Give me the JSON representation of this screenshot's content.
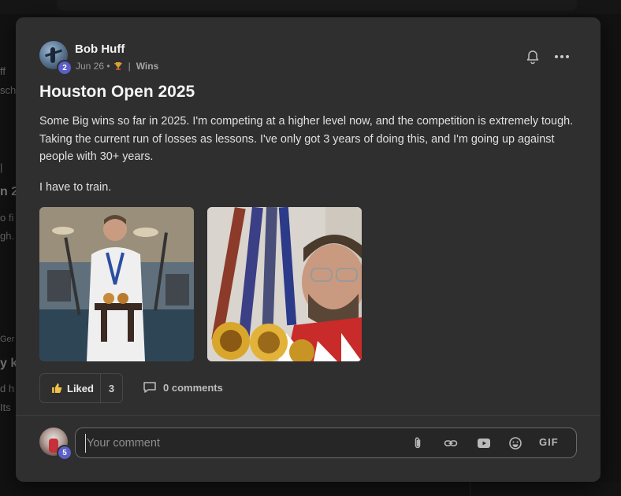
{
  "post": {
    "author": "Bob Huff",
    "author_level": "2",
    "date": "Jun 26 •",
    "category_separator": "|",
    "category": "Wins",
    "title": "Houston Open 2025",
    "paragraphs": [
      "Some Big wins so far in 2025. I'm competing at a higher level now, and the competition is extremely tough. Taking the current run of losses as lessons. I've only got 3 years of doing this, and I'm going up against people with 30+ years.",
      "I have to train."
    ],
    "images": [
      "karate-gi-medals-photo",
      "medals-selfie-photo"
    ],
    "like_label": "Liked",
    "like_count": "3",
    "comments_label": "0 comments"
  },
  "composer": {
    "user_level": "5",
    "placeholder": "Your comment",
    "gif_label": "GIF"
  },
  "background": {
    "snippets": [
      "ff",
      "sch",
      "|",
      "n 2",
      "o fi",
      "gh.",
      "Ger",
      "y k",
      "d h",
      "Its"
    ]
  },
  "icons": {
    "bell": "bell-icon",
    "more": "more-options-icon",
    "like": "thumbs-up-icon",
    "comment": "comment-bubble-icon",
    "attach": "paperclip-icon",
    "link": "link-icon",
    "video": "youtube-icon",
    "emoji": "emoji-icon",
    "trophy": "trophy-icon"
  },
  "colors": {
    "card_bg": "#2f2f30",
    "page_bg": "#121213",
    "level_badge": "#5b5fc7"
  }
}
